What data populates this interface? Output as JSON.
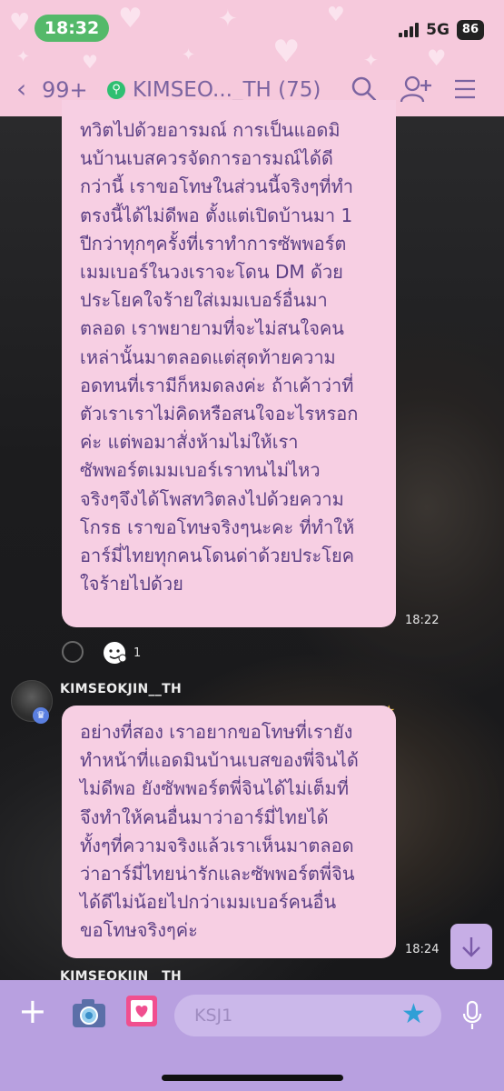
{
  "status_bar": {
    "time": "18:32",
    "network": "5G",
    "battery": "86"
  },
  "header": {
    "back_count": "99+",
    "chat_title": "KIMSEO..._TH (75)",
    "accent_color": "#7b63a0",
    "background_color": "#f6c9dc"
  },
  "messages": [
    {
      "text": "ทวิตไปด้วยอารมณ์ การเป็นแอดมิ\nนบ้านเบสควรจัดการอารมณ์ได้ดี\nกว่านี้ เราขอโทษในส่วนนี้จริงๆที่ทำ\nตรงนี้ได้ไม่ดีพอ ตั้งแต่เปิดบ้านมา 1\nปีกว่าทุกๆครั้งที่เราทำการซัพพอร์ต\nเมมเบอร์ในวงเราจะโดน DM ด้วย\nประโยคใจร้ายใส่เมมเบอร์อื่นมา\nตลอด เราพยายามที่จะไม่สนใจคน\nเหล่านั้นมาตลอดแต่สุดท้ายความ\nอดทนที่เรามีก็หมดลงค่ะ ถ้าเค้าว่าที่\nตัวเราเราไม่คิดหรือสนใจอะไรหรอก\nค่ะ แต่พอมาสั่งห้ามไม่ให้เรา\nซัพพอร์ตเมมเบอร์เราทนไม่ไหว\nจริงๆจึงได้โพสทวิตลงไปด้วยความ\nโกรธ เราขอโทษจริงๆนะคะ ที่ทำให้\nอาร์มี่ไทยทุกคนโดนด่าด้วยประโยค\nใจร้ายไปด้วย",
      "time": "18:22",
      "reaction_count": "1"
    },
    {
      "sender": "KIMSEOKJIN__TH",
      "text": "อย่างที่สอง เราอยากขอโทษที่เรายัง\nทำหน้าที่แอดมินบ้านเบสของพี่จินได้\nไม่ดีพอ ยังซัพพอร์ตพี่จินได้ไม่เต็มที่\nจึงทำให้คนอื่นมาว่าอาร์มี่ไทยได้\nทั้งๆที่ความจริงแล้วเราเห็นมาตลอด\nว่าอาร์มี่ไทยน่ารักและซัพพอร์ตพี่จิน\nได้ดีไม่น้อยไปกว่าเมมเบอร์คนอื่น\nขอโทษจริงๆค่ะ",
      "time": "18:24"
    },
    {
      "sender": "KIMSEOKJIN__TH"
    }
  ],
  "input_bar": {
    "placeholder": "KSJ1",
    "background_color": "#b8a0e0"
  },
  "bubble_color": "#f7cfe3",
  "bubble_text_color": "#5b3f84"
}
